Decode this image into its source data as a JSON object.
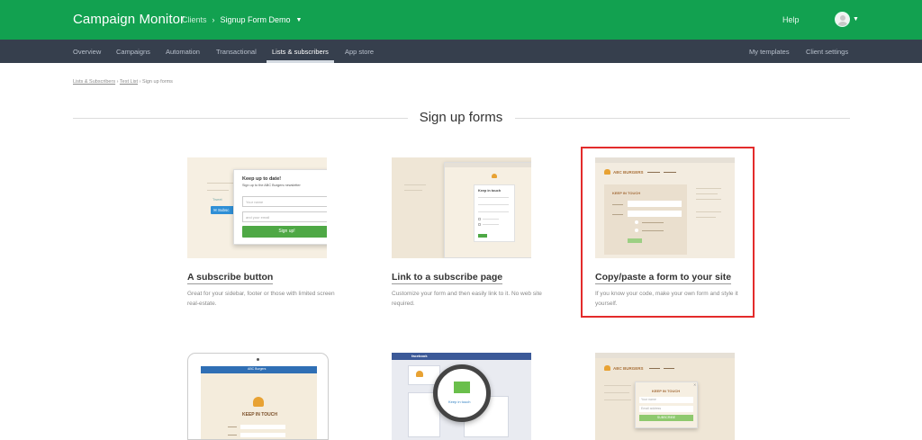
{
  "topbar": {
    "brand": "Campaign Monitor",
    "clients_label": "Clients",
    "separator": "›",
    "client_name": "Signup Form Demo",
    "help_label": "Help",
    "colors": {
      "topbar_bg": "#12a150",
      "navbar_bg": "#363f4d",
      "highlight": "#e32b2b"
    }
  },
  "nav": {
    "items": [
      "Overview",
      "Campaigns",
      "Automation",
      "Transactional",
      "Lists & subscribers",
      "App store"
    ],
    "active": "Lists & subscribers",
    "right_items": [
      "My templates",
      "Client settings"
    ]
  },
  "breadcrumb": {
    "items": [
      "Lists & Subscribers",
      "Test List",
      "Sign up forms"
    ],
    "separator": "›"
  },
  "page": {
    "title": "Sign up forms"
  },
  "cards": [
    {
      "title": "A subscribe button",
      "desc": "Great for your sidebar, footer or those with limited screen real-estate."
    },
    {
      "title": "Link to a subscribe page",
      "desc": "Customize your form and then easily link to it. No web site required."
    },
    {
      "title": "Copy/paste a form to your site",
      "desc": "If you know your code, make your own form and style it yourself."
    }
  ],
  "thumb1": {
    "heading": "Keep up to date!",
    "sub": "Sign up to the ABC Burgers newsletter",
    "name_placeholder": "Your name",
    "email_placeholder": "and your email",
    "button": "Sign up!",
    "subscribe_tab": "Subsc",
    "tweet_label": "Tweet"
  },
  "thumb2": {
    "heading": "Keep in touch"
  },
  "thumb3": {
    "logo": "ABC BURGERS",
    "heading": "KEEP IN TOUCH"
  },
  "thumb4": {
    "header": "ABC Burgers",
    "heading": "KEEP IN TOUCH"
  },
  "thumb5": {
    "brand": "facebook",
    "magnifier_text": "Keep in touch"
  },
  "thumb6": {
    "logo": "ABC BURGERS",
    "heading": "KEEP IN TOUCH",
    "name_placeholder": "Your name",
    "email_placeholder": "Email address",
    "button": "SUBSCRIBE"
  }
}
